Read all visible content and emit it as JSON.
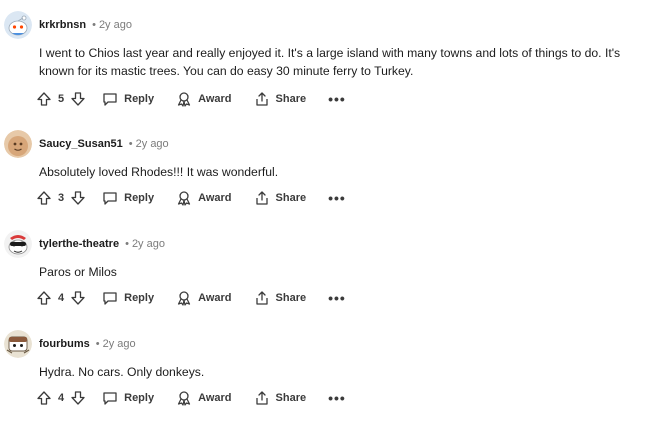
{
  "comments": [
    {
      "author": "krkrbnsn",
      "separator": "•",
      "time": "2y ago",
      "text": "I went to Chios last year and really enjoyed it. It's a large island with many towns and lots of things to do. It's known for its mastic trees. You can do easy 30 minute ferry to Turkey.",
      "votes": "5",
      "avatar_color": "#dbe7f3"
    },
    {
      "author": "Saucy_Susan51",
      "separator": "•",
      "time": "2y ago",
      "text": "Absolutely loved Rhodes!!! It was wonderful.",
      "votes": "3",
      "avatar_color": "#d7a679"
    },
    {
      "author": "tylerthe-theatre",
      "separator": "•",
      "time": "2y ago",
      "text": "Paros or Milos",
      "votes": "4",
      "avatar_color": "#f2f2f2"
    },
    {
      "author": "fourbums",
      "separator": "•",
      "time": "2y ago",
      "text": "Hydra. No cars. Only donkeys.",
      "votes": "4",
      "avatar_color": "#e9e2d3"
    }
  ],
  "actions": {
    "reply_label": "Reply",
    "award_label": "Award",
    "share_label": "Share",
    "more_label": "•••"
  },
  "icons": {
    "upvote": "upvote-arrow-icon",
    "downvote": "downvote-arrow-icon",
    "reply": "comment-bubble-icon",
    "award": "award-ribbon-icon",
    "share": "share-upload-icon",
    "more": "more-dots-icon"
  }
}
